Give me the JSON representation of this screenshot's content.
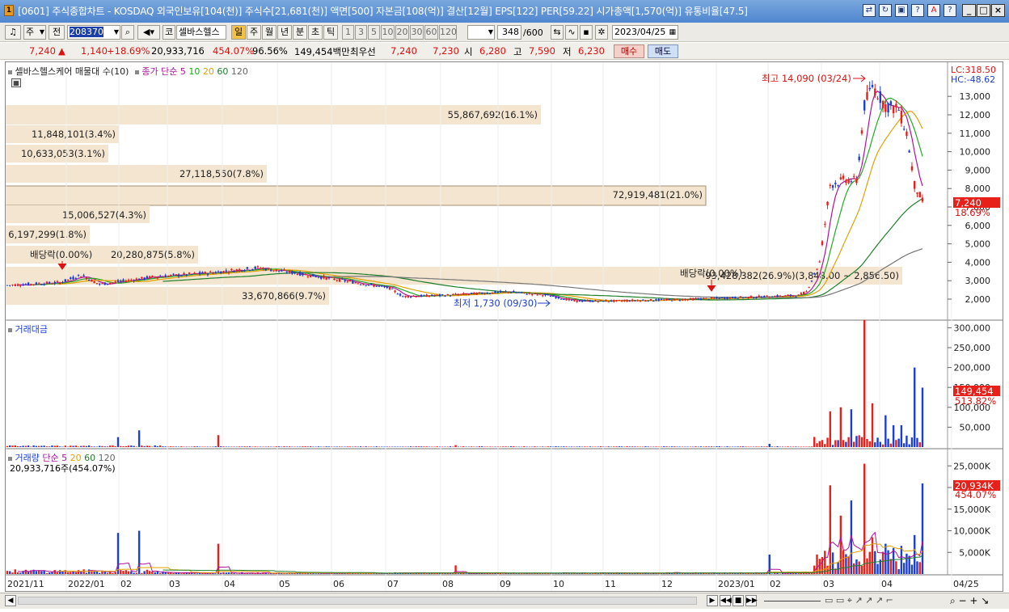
{
  "window": {
    "title": "[0601] 주식종합차트 - KOSDAQ 외국인보유[104(천)] 주식수[21,681(천)] 액면[500] 자본금[108(억)] 결산[12월] EPS[122] PER[59.22] 시가총액[1,570(억)] 유통비율[47.5]",
    "icon_label": "1"
  },
  "toolbar": {
    "type_select": "주",
    "prev_label": "전",
    "code_input": "208370",
    "ko_label": "코",
    "stock_name": "셀바스헬스",
    "periods": [
      "일",
      "주",
      "월",
      "년",
      "분",
      "초",
      "틱"
    ],
    "active_period": "일",
    "intervals": [
      "1",
      "3",
      "5",
      "10",
      "20",
      "30",
      "60",
      "120"
    ],
    "count_value": "348",
    "count_total": "/600",
    "date_value": "2023/04/25"
  },
  "infobar": {
    "price": "7,240",
    "change": "1,140",
    "change_pct": "+18.69%",
    "volume": "20,933,716",
    "vol_ratio": "454.07%",
    "ratio2": "96.56%",
    "amount": "149,454백만",
    "best_label": "최우선",
    "best_ask": "7,240",
    "best_bid": "7,230",
    "open_label": "시",
    "open": "6,280",
    "high_label": "고",
    "high": "7,590",
    "low_label": "저",
    "low": "6,230",
    "buy_label": "매수",
    "sell_label": "매도"
  },
  "price_panel": {
    "legend_title": "셀바스헬스케어 매물대 수(10)",
    "ma_label": "종가 단순 5",
    "ma_periods": [
      "10",
      "20",
      "60",
      "120"
    ],
    "lc": "LC:318.50",
    "hc": "HC:-48.62",
    "high_note": "최고 14,090 (03/24)",
    "low_note": "최저 1,730 (09/30)",
    "dividend_note": "배당락(0.00%)",
    "current_price_tag": "7,240",
    "current_pct_tag": "18.69%",
    "y_ticks": [
      "13,000",
      "12,000",
      "11,000",
      "10,000",
      "9,000",
      "8,000",
      "7,000",
      "6,000",
      "5,000",
      "4,000",
      "3,000",
      "2,000"
    ]
  },
  "volume_profile": [
    {
      "label": "55,867,692(16.1%)",
      "share": 0.161
    },
    {
      "label": "11,848,101(3.4%)",
      "share": 0.034
    },
    {
      "label": "10,633,053(3.1%)",
      "share": 0.031
    },
    {
      "label": "27,118,550(7.8%)",
      "share": 0.078
    },
    {
      "label": "72,919,481(21.0%)",
      "share": 0.21
    },
    {
      "label": "15,006,527(4.3%)",
      "share": 0.043
    },
    {
      "label": "6,197,299(1.8%)",
      "share": 0.018
    },
    {
      "label": "20,280,875(5.8%)",
      "share": 0.058
    },
    {
      "label": "93,428,382(26.9%)(3,848.00 ~ 2,856.50)",
      "share": 0.269
    },
    {
      "label": "33,670,866(9.7%)",
      "share": 0.097
    }
  ],
  "amount_panel": {
    "title": "거래대금",
    "y_ticks": [
      "300,000",
      "250,000",
      "200,000",
      "150,000",
      "100,000",
      "50,000"
    ],
    "tag_value": "149,454",
    "tag_pct": "513.82%"
  },
  "volume_panel": {
    "title": "거래량",
    "ma_label": "단순 5",
    "ma_periods": [
      "20",
      "60",
      "120"
    ],
    "current": "20,933,716주(454.07%)",
    "y_ticks": [
      "25,000K",
      "20,000K",
      "15,000K",
      "10,000K",
      "5,000K"
    ],
    "tag_value": "20,934K",
    "tag_pct": "454.07%"
  },
  "x_axis": [
    "2021/11",
    "2022/01",
    "02",
    "03",
    "04",
    "05",
    "06",
    "07",
    "08",
    "09",
    "10",
    "11",
    "12",
    "2023/01",
    "02",
    "03",
    "04",
    "04/25"
  ],
  "colors": {
    "up": "#e8201a",
    "down": "#1b3fd0",
    "profile": "#f3e5d0",
    "title_bar": "#5a8fd6"
  }
}
